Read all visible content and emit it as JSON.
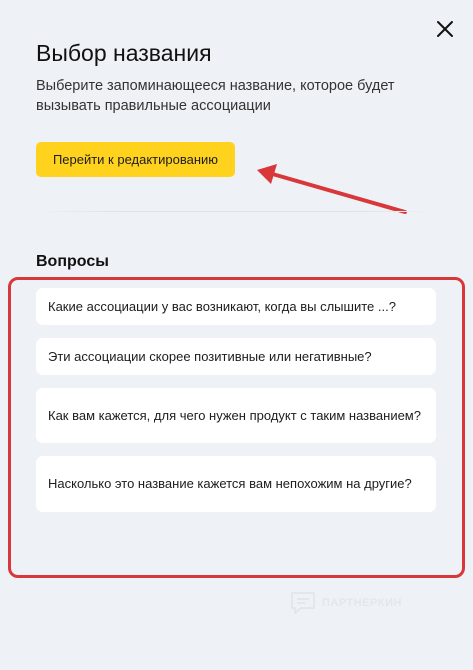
{
  "dialog": {
    "title": "Выбор названия",
    "subtitle": "Выберите запоминающееся название, которое будет вызывать правильные ассоциации",
    "edit_button_label": "Перейти к редактированию",
    "close_icon": "close-icon"
  },
  "questions": {
    "title": "Вопросы",
    "items": [
      "Какие ассоциации у вас возникают, когда вы слышите ...?",
      "Эти ассоциации скорее позитивные или негативные?",
      "Как вам кажется, для чего нужен продукт с таким названием?",
      "Насколько это название кажется вам непохожим на другие?"
    ]
  },
  "annotations": {
    "arrow_color": "#d9383a",
    "highlight_color": "#d9383a"
  },
  "watermark": {
    "text": "ПАРТНЕРКИН"
  },
  "colors": {
    "background": "#eef2f6",
    "accent": "#ffd21e",
    "card": "#ffffff"
  }
}
